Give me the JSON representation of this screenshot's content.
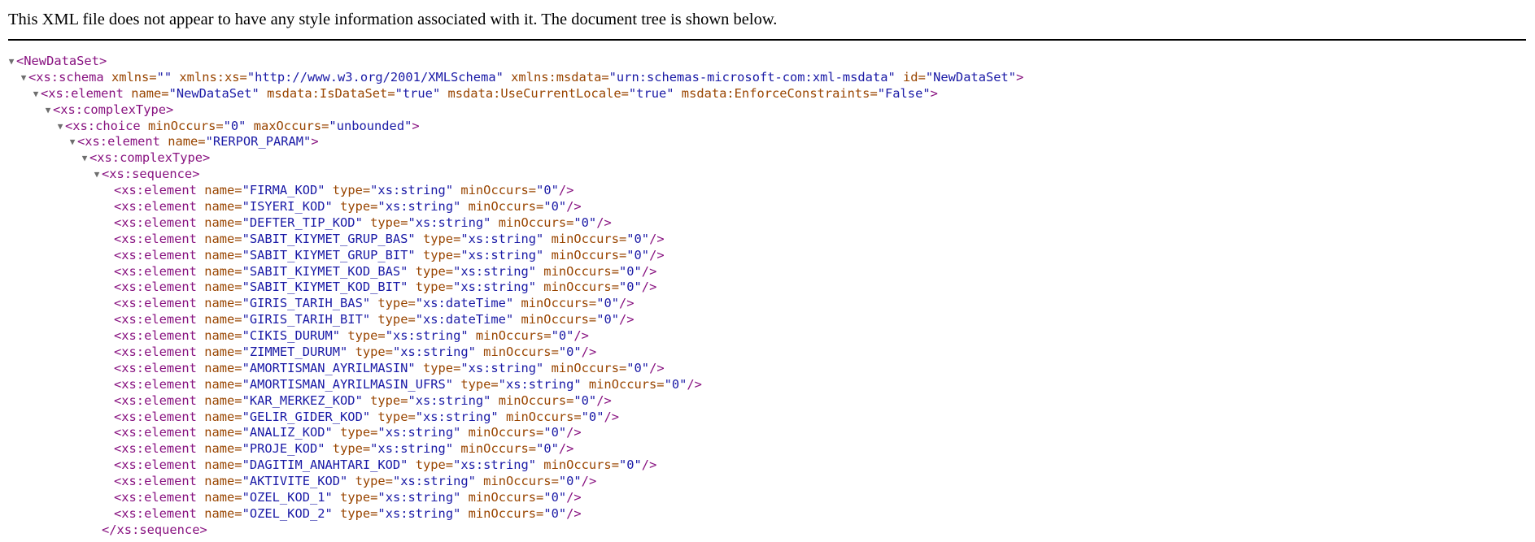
{
  "notice": "This XML file does not appear to have any style information associated with it. The document tree is shown below.",
  "tree": [
    {
      "indent": 0,
      "collapsible": true,
      "open": "<NewDataSet",
      "attrs": [],
      "end": ">"
    },
    {
      "indent": 1,
      "collapsible": true,
      "open": "<xs:schema",
      "attrs": [
        {
          "name": "xmlns",
          "value": "\"\""
        },
        {
          "name": "xmlns:xs",
          "value": "\"http://www.w3.org/2001/XMLSchema\""
        },
        {
          "name": "xmlns:msdata",
          "value": "\"urn:schemas-microsoft-com:xml-msdata\""
        },
        {
          "name": "id",
          "value": "\"NewDataSet\""
        }
      ],
      "end": ">"
    },
    {
      "indent": 2,
      "collapsible": true,
      "open": "<xs:element",
      "attrs": [
        {
          "name": "name",
          "value": "\"NewDataSet\""
        },
        {
          "name": "msdata:IsDataSet",
          "value": "\"true\""
        },
        {
          "name": "msdata:UseCurrentLocale",
          "value": "\"true\""
        },
        {
          "name": "msdata:EnforceConstraints",
          "value": "\"False\""
        }
      ],
      "end": ">"
    },
    {
      "indent": 3,
      "collapsible": true,
      "open": "<xs:complexType",
      "attrs": [],
      "end": ">"
    },
    {
      "indent": 4,
      "collapsible": true,
      "open": "<xs:choice",
      "attrs": [
        {
          "name": "minOccurs",
          "value": "\"0\""
        },
        {
          "name": "maxOccurs",
          "value": "\"unbounded\""
        }
      ],
      "end": ">"
    },
    {
      "indent": 5,
      "collapsible": true,
      "open": "<xs:element",
      "attrs": [
        {
          "name": "name",
          "value": "\"RERPOR_PARAM\""
        }
      ],
      "end": ">"
    },
    {
      "indent": 6,
      "collapsible": true,
      "open": "<xs:complexType",
      "attrs": [],
      "end": ">"
    },
    {
      "indent": 7,
      "collapsible": true,
      "open": "<xs:sequence",
      "attrs": [],
      "end": ">"
    },
    {
      "indent": 8,
      "collapsible": false,
      "open": "<xs:element",
      "attrs": [
        {
          "name": "name",
          "value": "\"FIRMA_KOD\""
        },
        {
          "name": "type",
          "value": "\"xs:string\""
        },
        {
          "name": "minOccurs",
          "value": "\"0\""
        }
      ],
      "end": "/>"
    },
    {
      "indent": 8,
      "collapsible": false,
      "open": "<xs:element",
      "attrs": [
        {
          "name": "name",
          "value": "\"ISYERI_KOD\""
        },
        {
          "name": "type",
          "value": "\"xs:string\""
        },
        {
          "name": "minOccurs",
          "value": "\"0\""
        }
      ],
      "end": "/>"
    },
    {
      "indent": 8,
      "collapsible": false,
      "open": "<xs:element",
      "attrs": [
        {
          "name": "name",
          "value": "\"DEFTER_TIP_KOD\""
        },
        {
          "name": "type",
          "value": "\"xs:string\""
        },
        {
          "name": "minOccurs",
          "value": "\"0\""
        }
      ],
      "end": "/>"
    },
    {
      "indent": 8,
      "collapsible": false,
      "open": "<xs:element",
      "attrs": [
        {
          "name": "name",
          "value": "\"SABIT_KIYMET_GRUP_BAS\""
        },
        {
          "name": "type",
          "value": "\"xs:string\""
        },
        {
          "name": "minOccurs",
          "value": "\"0\""
        }
      ],
      "end": "/>"
    },
    {
      "indent": 8,
      "collapsible": false,
      "open": "<xs:element",
      "attrs": [
        {
          "name": "name",
          "value": "\"SABIT_KIYMET_GRUP_BIT\""
        },
        {
          "name": "type",
          "value": "\"xs:string\""
        },
        {
          "name": "minOccurs",
          "value": "\"0\""
        }
      ],
      "end": "/>"
    },
    {
      "indent": 8,
      "collapsible": false,
      "open": "<xs:element",
      "attrs": [
        {
          "name": "name",
          "value": "\"SABIT_KIYMET_KOD_BAS\""
        },
        {
          "name": "type",
          "value": "\"xs:string\""
        },
        {
          "name": "minOccurs",
          "value": "\"0\""
        }
      ],
      "end": "/>"
    },
    {
      "indent": 8,
      "collapsible": false,
      "open": "<xs:element",
      "attrs": [
        {
          "name": "name",
          "value": "\"SABIT_KIYMET_KOD_BIT\""
        },
        {
          "name": "type",
          "value": "\"xs:string\""
        },
        {
          "name": "minOccurs",
          "value": "\"0\""
        }
      ],
      "end": "/>"
    },
    {
      "indent": 8,
      "collapsible": false,
      "open": "<xs:element",
      "attrs": [
        {
          "name": "name",
          "value": "\"GIRIS_TARIH_BAS\""
        },
        {
          "name": "type",
          "value": "\"xs:dateTime\""
        },
        {
          "name": "minOccurs",
          "value": "\"0\""
        }
      ],
      "end": "/>"
    },
    {
      "indent": 8,
      "collapsible": false,
      "open": "<xs:element",
      "attrs": [
        {
          "name": "name",
          "value": "\"GIRIS_TARIH_BIT\""
        },
        {
          "name": "type",
          "value": "\"xs:dateTime\""
        },
        {
          "name": "minOccurs",
          "value": "\"0\""
        }
      ],
      "end": "/>"
    },
    {
      "indent": 8,
      "collapsible": false,
      "open": "<xs:element",
      "attrs": [
        {
          "name": "name",
          "value": "\"CIKIS_DURUM\""
        },
        {
          "name": "type",
          "value": "\"xs:string\""
        },
        {
          "name": "minOccurs",
          "value": "\"0\""
        }
      ],
      "end": "/>"
    },
    {
      "indent": 8,
      "collapsible": false,
      "open": "<xs:element",
      "attrs": [
        {
          "name": "name",
          "value": "\"ZIMMET_DURUM\""
        },
        {
          "name": "type",
          "value": "\"xs:string\""
        },
        {
          "name": "minOccurs",
          "value": "\"0\""
        }
      ],
      "end": "/>"
    },
    {
      "indent": 8,
      "collapsible": false,
      "open": "<xs:element",
      "attrs": [
        {
          "name": "name",
          "value": "\"AMORTISMAN_AYRILMASIN\""
        },
        {
          "name": "type",
          "value": "\"xs:string\""
        },
        {
          "name": "minOccurs",
          "value": "\"0\""
        }
      ],
      "end": "/>"
    },
    {
      "indent": 8,
      "collapsible": false,
      "open": "<xs:element",
      "attrs": [
        {
          "name": "name",
          "value": "\"AMORTISMAN_AYRILMASIN_UFRS\""
        },
        {
          "name": "type",
          "value": "\"xs:string\""
        },
        {
          "name": "minOccurs",
          "value": "\"0\""
        }
      ],
      "end": "/>"
    },
    {
      "indent": 8,
      "collapsible": false,
      "open": "<xs:element",
      "attrs": [
        {
          "name": "name",
          "value": "\"KAR_MERKEZ_KOD\""
        },
        {
          "name": "type",
          "value": "\"xs:string\""
        },
        {
          "name": "minOccurs",
          "value": "\"0\""
        }
      ],
      "end": "/>"
    },
    {
      "indent": 8,
      "collapsible": false,
      "open": "<xs:element",
      "attrs": [
        {
          "name": "name",
          "value": "\"GELIR_GIDER_KOD\""
        },
        {
          "name": "type",
          "value": "\"xs:string\""
        },
        {
          "name": "minOccurs",
          "value": "\"0\""
        }
      ],
      "end": "/>"
    },
    {
      "indent": 8,
      "collapsible": false,
      "open": "<xs:element",
      "attrs": [
        {
          "name": "name",
          "value": "\"ANALIZ_KOD\""
        },
        {
          "name": "type",
          "value": "\"xs:string\""
        },
        {
          "name": "minOccurs",
          "value": "\"0\""
        }
      ],
      "end": "/>"
    },
    {
      "indent": 8,
      "collapsible": false,
      "open": "<xs:element",
      "attrs": [
        {
          "name": "name",
          "value": "\"PROJE_KOD\""
        },
        {
          "name": "type",
          "value": "\"xs:string\""
        },
        {
          "name": "minOccurs",
          "value": "\"0\""
        }
      ],
      "end": "/>"
    },
    {
      "indent": 8,
      "collapsible": false,
      "open": "<xs:element",
      "attrs": [
        {
          "name": "name",
          "value": "\"DAGITIM_ANAHTARI_KOD\""
        },
        {
          "name": "type",
          "value": "\"xs:string\""
        },
        {
          "name": "minOccurs",
          "value": "\"0\""
        }
      ],
      "end": "/>"
    },
    {
      "indent": 8,
      "collapsible": false,
      "open": "<xs:element",
      "attrs": [
        {
          "name": "name",
          "value": "\"AKTIVITE_KOD\""
        },
        {
          "name": "type",
          "value": "\"xs:string\""
        },
        {
          "name": "minOccurs",
          "value": "\"0\""
        }
      ],
      "end": "/>"
    },
    {
      "indent": 8,
      "collapsible": false,
      "open": "<xs:element",
      "attrs": [
        {
          "name": "name",
          "value": "\"OZEL_KOD_1\""
        },
        {
          "name": "type",
          "value": "\"xs:string\""
        },
        {
          "name": "minOccurs",
          "value": "\"0\""
        }
      ],
      "end": "/>"
    },
    {
      "indent": 8,
      "collapsible": false,
      "open": "<xs:element",
      "attrs": [
        {
          "name": "name",
          "value": "\"OZEL_KOD_2\""
        },
        {
          "name": "type",
          "value": "\"xs:string\""
        },
        {
          "name": "minOccurs",
          "value": "\"0\""
        }
      ],
      "end": "/>"
    },
    {
      "indent": 7,
      "collapsible": false,
      "open": "</xs:sequence",
      "attrs": [],
      "end": ">"
    }
  ],
  "colors": {
    "tag": "#881280",
    "attribute_name": "#994500",
    "attribute_value": "#1a1aa6",
    "toggle_arrow": "#6e6e6e"
  },
  "icons": {
    "expanded": "collapse-arrow-icon"
  }
}
